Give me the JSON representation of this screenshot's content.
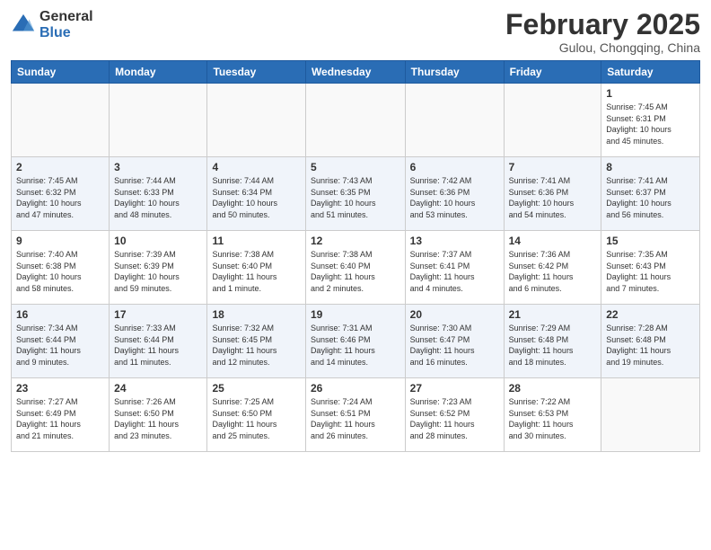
{
  "header": {
    "logo_line1": "General",
    "logo_line2": "Blue",
    "month_title": "February 2025",
    "subtitle": "Gulou, Chongqing, China"
  },
  "days_of_week": [
    "Sunday",
    "Monday",
    "Tuesday",
    "Wednesday",
    "Thursday",
    "Friday",
    "Saturday"
  ],
  "weeks": [
    {
      "alt": false,
      "days": [
        {
          "num": "",
          "info": ""
        },
        {
          "num": "",
          "info": ""
        },
        {
          "num": "",
          "info": ""
        },
        {
          "num": "",
          "info": ""
        },
        {
          "num": "",
          "info": ""
        },
        {
          "num": "",
          "info": ""
        },
        {
          "num": "1",
          "info": "Sunrise: 7:45 AM\nSunset: 6:31 PM\nDaylight: 10 hours\nand 45 minutes."
        }
      ]
    },
    {
      "alt": true,
      "days": [
        {
          "num": "2",
          "info": "Sunrise: 7:45 AM\nSunset: 6:32 PM\nDaylight: 10 hours\nand 47 minutes."
        },
        {
          "num": "3",
          "info": "Sunrise: 7:44 AM\nSunset: 6:33 PM\nDaylight: 10 hours\nand 48 minutes."
        },
        {
          "num": "4",
          "info": "Sunrise: 7:44 AM\nSunset: 6:34 PM\nDaylight: 10 hours\nand 50 minutes."
        },
        {
          "num": "5",
          "info": "Sunrise: 7:43 AM\nSunset: 6:35 PM\nDaylight: 10 hours\nand 51 minutes."
        },
        {
          "num": "6",
          "info": "Sunrise: 7:42 AM\nSunset: 6:36 PM\nDaylight: 10 hours\nand 53 minutes."
        },
        {
          "num": "7",
          "info": "Sunrise: 7:41 AM\nSunset: 6:36 PM\nDaylight: 10 hours\nand 54 minutes."
        },
        {
          "num": "8",
          "info": "Sunrise: 7:41 AM\nSunset: 6:37 PM\nDaylight: 10 hours\nand 56 minutes."
        }
      ]
    },
    {
      "alt": false,
      "days": [
        {
          "num": "9",
          "info": "Sunrise: 7:40 AM\nSunset: 6:38 PM\nDaylight: 10 hours\nand 58 minutes."
        },
        {
          "num": "10",
          "info": "Sunrise: 7:39 AM\nSunset: 6:39 PM\nDaylight: 10 hours\nand 59 minutes."
        },
        {
          "num": "11",
          "info": "Sunrise: 7:38 AM\nSunset: 6:40 PM\nDaylight: 11 hours\nand 1 minute."
        },
        {
          "num": "12",
          "info": "Sunrise: 7:38 AM\nSunset: 6:40 PM\nDaylight: 11 hours\nand 2 minutes."
        },
        {
          "num": "13",
          "info": "Sunrise: 7:37 AM\nSunset: 6:41 PM\nDaylight: 11 hours\nand 4 minutes."
        },
        {
          "num": "14",
          "info": "Sunrise: 7:36 AM\nSunset: 6:42 PM\nDaylight: 11 hours\nand 6 minutes."
        },
        {
          "num": "15",
          "info": "Sunrise: 7:35 AM\nSunset: 6:43 PM\nDaylight: 11 hours\nand 7 minutes."
        }
      ]
    },
    {
      "alt": true,
      "days": [
        {
          "num": "16",
          "info": "Sunrise: 7:34 AM\nSunset: 6:44 PM\nDaylight: 11 hours\nand 9 minutes."
        },
        {
          "num": "17",
          "info": "Sunrise: 7:33 AM\nSunset: 6:44 PM\nDaylight: 11 hours\nand 11 minutes."
        },
        {
          "num": "18",
          "info": "Sunrise: 7:32 AM\nSunset: 6:45 PM\nDaylight: 11 hours\nand 12 minutes."
        },
        {
          "num": "19",
          "info": "Sunrise: 7:31 AM\nSunset: 6:46 PM\nDaylight: 11 hours\nand 14 minutes."
        },
        {
          "num": "20",
          "info": "Sunrise: 7:30 AM\nSunset: 6:47 PM\nDaylight: 11 hours\nand 16 minutes."
        },
        {
          "num": "21",
          "info": "Sunrise: 7:29 AM\nSunset: 6:48 PM\nDaylight: 11 hours\nand 18 minutes."
        },
        {
          "num": "22",
          "info": "Sunrise: 7:28 AM\nSunset: 6:48 PM\nDaylight: 11 hours\nand 19 minutes."
        }
      ]
    },
    {
      "alt": false,
      "days": [
        {
          "num": "23",
          "info": "Sunrise: 7:27 AM\nSunset: 6:49 PM\nDaylight: 11 hours\nand 21 minutes."
        },
        {
          "num": "24",
          "info": "Sunrise: 7:26 AM\nSunset: 6:50 PM\nDaylight: 11 hours\nand 23 minutes."
        },
        {
          "num": "25",
          "info": "Sunrise: 7:25 AM\nSunset: 6:50 PM\nDaylight: 11 hours\nand 25 minutes."
        },
        {
          "num": "26",
          "info": "Sunrise: 7:24 AM\nSunset: 6:51 PM\nDaylight: 11 hours\nand 26 minutes."
        },
        {
          "num": "27",
          "info": "Sunrise: 7:23 AM\nSunset: 6:52 PM\nDaylight: 11 hours\nand 28 minutes."
        },
        {
          "num": "28",
          "info": "Sunrise: 7:22 AM\nSunset: 6:53 PM\nDaylight: 11 hours\nand 30 minutes."
        },
        {
          "num": "",
          "info": ""
        }
      ]
    }
  ]
}
